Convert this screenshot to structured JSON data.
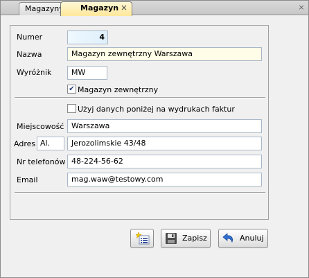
{
  "tabs": {
    "inactive_label": "Magazyny",
    "active_label": "Magazyn",
    "close_glyph": "×"
  },
  "form": {
    "numer": {
      "label": "Numer",
      "value": "4"
    },
    "nazwa": {
      "label": "Nazwa",
      "value": "Magazyn zewnętrzny Warszawa"
    },
    "wyroznik": {
      "label": "Wyróżnik",
      "value": "MW"
    },
    "magazyn_zewnetrzny": {
      "label": "Magazyn zewnętrzny",
      "checked": true
    },
    "uzyj_danych": {
      "label": "Użyj danych poniżej na wydrukach faktur",
      "checked": false
    },
    "miejscowosc": {
      "label": "Miejscowość",
      "value": "Warszawa"
    },
    "adres": {
      "label": "Adres",
      "prefix": "Al.",
      "value": "Jerozolimskie 43/48"
    },
    "telefon": {
      "label": "Nr telefonów",
      "value": "48-224-56-62"
    },
    "email": {
      "label": "Email",
      "value": "mag.waw@testowy.com"
    }
  },
  "buttons": {
    "save_label": "Zapisz",
    "cancel_label": "Anuluj"
  },
  "icons": {
    "list_button": "list-new-icon",
    "save": "floppy-disk-icon",
    "cancel": "undo-arrow-icon"
  }
}
